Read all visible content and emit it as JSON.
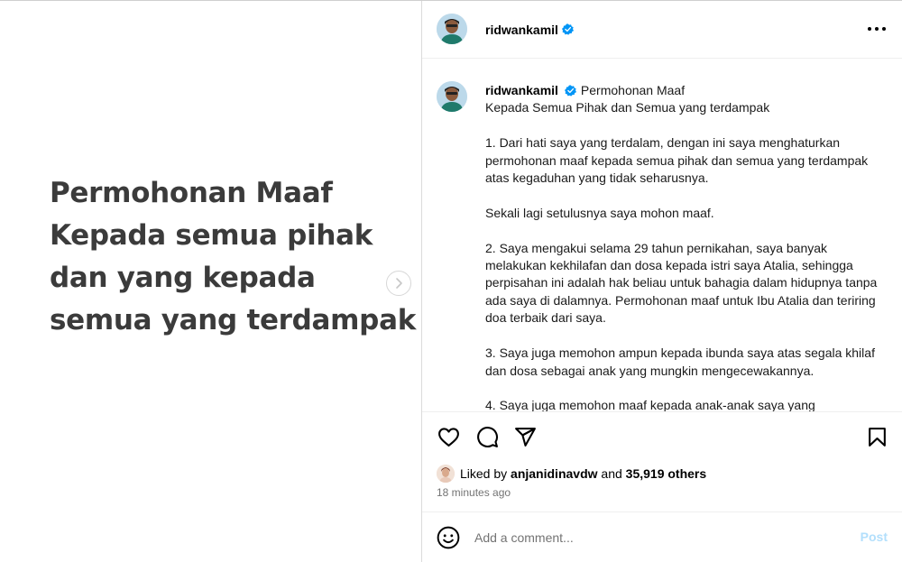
{
  "media": {
    "lines": [
      "Permohonan Maaf",
      "Kepada semua pihak",
      "dan yang kepada",
      "semua yang terdampak"
    ],
    "next_icon": "chevron-right-icon"
  },
  "header": {
    "username": "ridwankamil",
    "verified_icon": "verified-badge-icon",
    "more_icon": "more-options-icon"
  },
  "caption": {
    "username": "ridwankamil",
    "text": "Permohonan Maaf\nKepada Semua Pihak dan Semua yang terdampak\n\n1. Dari hati saya yang terdalam, dengan ini saya menghaturkan permohonan maaf kepada semua pihak dan semua yang terdampak atas kegaduhan yang tidak seharusnya.\n\nSekali lagi setulusnya saya mohon maaf.\n\n2. Saya mengakui selama 29 tahun pernikahan, saya banyak melakukan kekhilafan dan dosa kepada istri saya Atalia, sehingga perpisahan ini adalah hak beliau untuk bahagia dalam hidupnya tanpa ada saya di dalamnya. Permohonan maaf untuk Ibu Atalia dan teriring doa terbaik dari saya.\n\n3. Saya juga memohon ampun kepada ibunda saya atas segala khilaf dan dosa sebagai anak yang mungkin mengecewakannya.\n\n4. Saya juga memohon maaf kepada anak-anak saya yang"
  },
  "actions": {
    "like_icon": "heart-icon",
    "comment_icon": "comment-icon",
    "share_icon": "share-icon",
    "save_icon": "bookmark-icon"
  },
  "likes": {
    "prefix": "Liked by",
    "user": "anjanidinavdw",
    "connector": "and",
    "others": "35,919 others"
  },
  "time_ago": "18 minutes ago",
  "comment": {
    "placeholder": "Add a comment...",
    "post_label": "Post",
    "emoji_icon": "emoji-icon"
  },
  "colors": {
    "verified": "#0095f6",
    "post_disabled": "#b2dffc",
    "muted": "#737373",
    "media_text": "#3b3b3b"
  }
}
